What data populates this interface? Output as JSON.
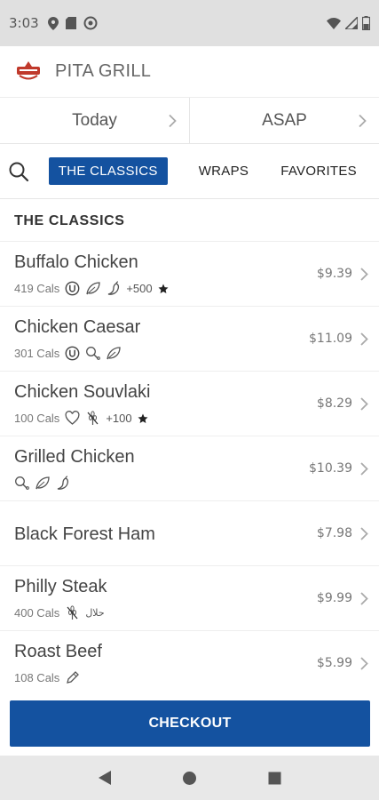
{
  "status_bar": {
    "time": "3:03"
  },
  "header": {
    "title": "PITA GRILL"
  },
  "order_when": {
    "day": "Today",
    "time": "ASAP"
  },
  "tabs": [
    "THE CLASSICS",
    "WRAPS",
    "FAVORITES"
  ],
  "section_title": "THE CLASSICS",
  "menu_items": [
    {
      "name": "Buffalo Chicken",
      "cals": "419 Cals",
      "price": "$9.39",
      "points": "+500",
      "icons": [
        "u-circle-icon",
        "leaf-icon",
        "pepper-icon"
      ]
    },
    {
      "name": "Chicken Caesar",
      "cals": "301 Cals",
      "price": "$11.09",
      "points": "",
      "icons": [
        "u-circle-icon",
        "drumstick-icon",
        "leaf-icon"
      ]
    },
    {
      "name": "Chicken Souvlaki",
      "cals": "100 Cals",
      "price": "$8.29",
      "points": "+100",
      "icons": [
        "heart-icon",
        "no-gluten-icon"
      ]
    },
    {
      "name": "Grilled Chicken",
      "cals": "",
      "price": "$10.39",
      "points": "",
      "icons": [
        "drumstick-icon",
        "leaf-icon",
        "pepper-icon"
      ]
    },
    {
      "name": "Black Forest Ham",
      "cals": "",
      "price": "$7.98",
      "points": "",
      "icons": []
    },
    {
      "name": "Philly Steak",
      "cals": "400 Cals",
      "price": "$9.99",
      "points": "",
      "icons": [
        "no-gluten-icon",
        "halal-icon"
      ]
    },
    {
      "name": "Roast Beef",
      "cals": "108 Cals",
      "price": "$5.99",
      "points": "",
      "icons": [
        "pencil-icon"
      ]
    }
  ],
  "checkout": {
    "label": "CHECKOUT"
  },
  "halal_text": "حلال",
  "colors": {
    "brand_blue": "#1452a0",
    "status_bar_bg": "#e0e0e0"
  }
}
